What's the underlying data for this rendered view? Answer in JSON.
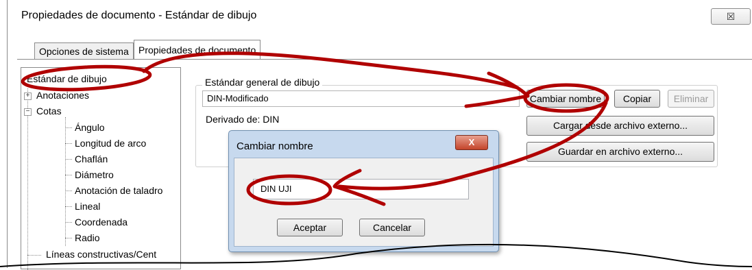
{
  "window": {
    "title": "Propiedades de documento - Estándar de dibujo",
    "close_label": "☒"
  },
  "tabs": [
    {
      "label": "Opciones de sistema"
    },
    {
      "label": "Propiedades de documento"
    }
  ],
  "tree": {
    "items": [
      {
        "label": "Estándar de dibujo"
      },
      {
        "label": "Anotaciones"
      },
      {
        "label": "Cotas"
      },
      {
        "label": "Ángulo"
      },
      {
        "label": "Longitud de arco"
      },
      {
        "label": "Chaflán"
      },
      {
        "label": "Diámetro"
      },
      {
        "label": "Anotación de taladro"
      },
      {
        "label": "Lineal"
      },
      {
        "label": "Coordenada"
      },
      {
        "label": "Radio"
      },
      {
        "label": "Líneas constructivas/Cent"
      }
    ]
  },
  "standard": {
    "group_label": "Estándar general de dibujo",
    "current_value": "DIN-Modificado",
    "derived_label": "Derivado de: DIN",
    "rename_button": "Cambiar nombre",
    "copy_button": "Copiar",
    "delete_button": "Eliminar",
    "load_button": "Cargar desde archivo externo...",
    "save_button": "Guardar en archivo externo..."
  },
  "dialog": {
    "title": "Cambiar nombre",
    "close_label": "X",
    "input_value": "DIN UJI",
    "ok_button": "Aceptar",
    "cancel_button": "Cancelar"
  },
  "colors": {
    "annotation": "#b00000",
    "dialog_frame": "#c7d9ee",
    "close_red": "#c4442b"
  }
}
